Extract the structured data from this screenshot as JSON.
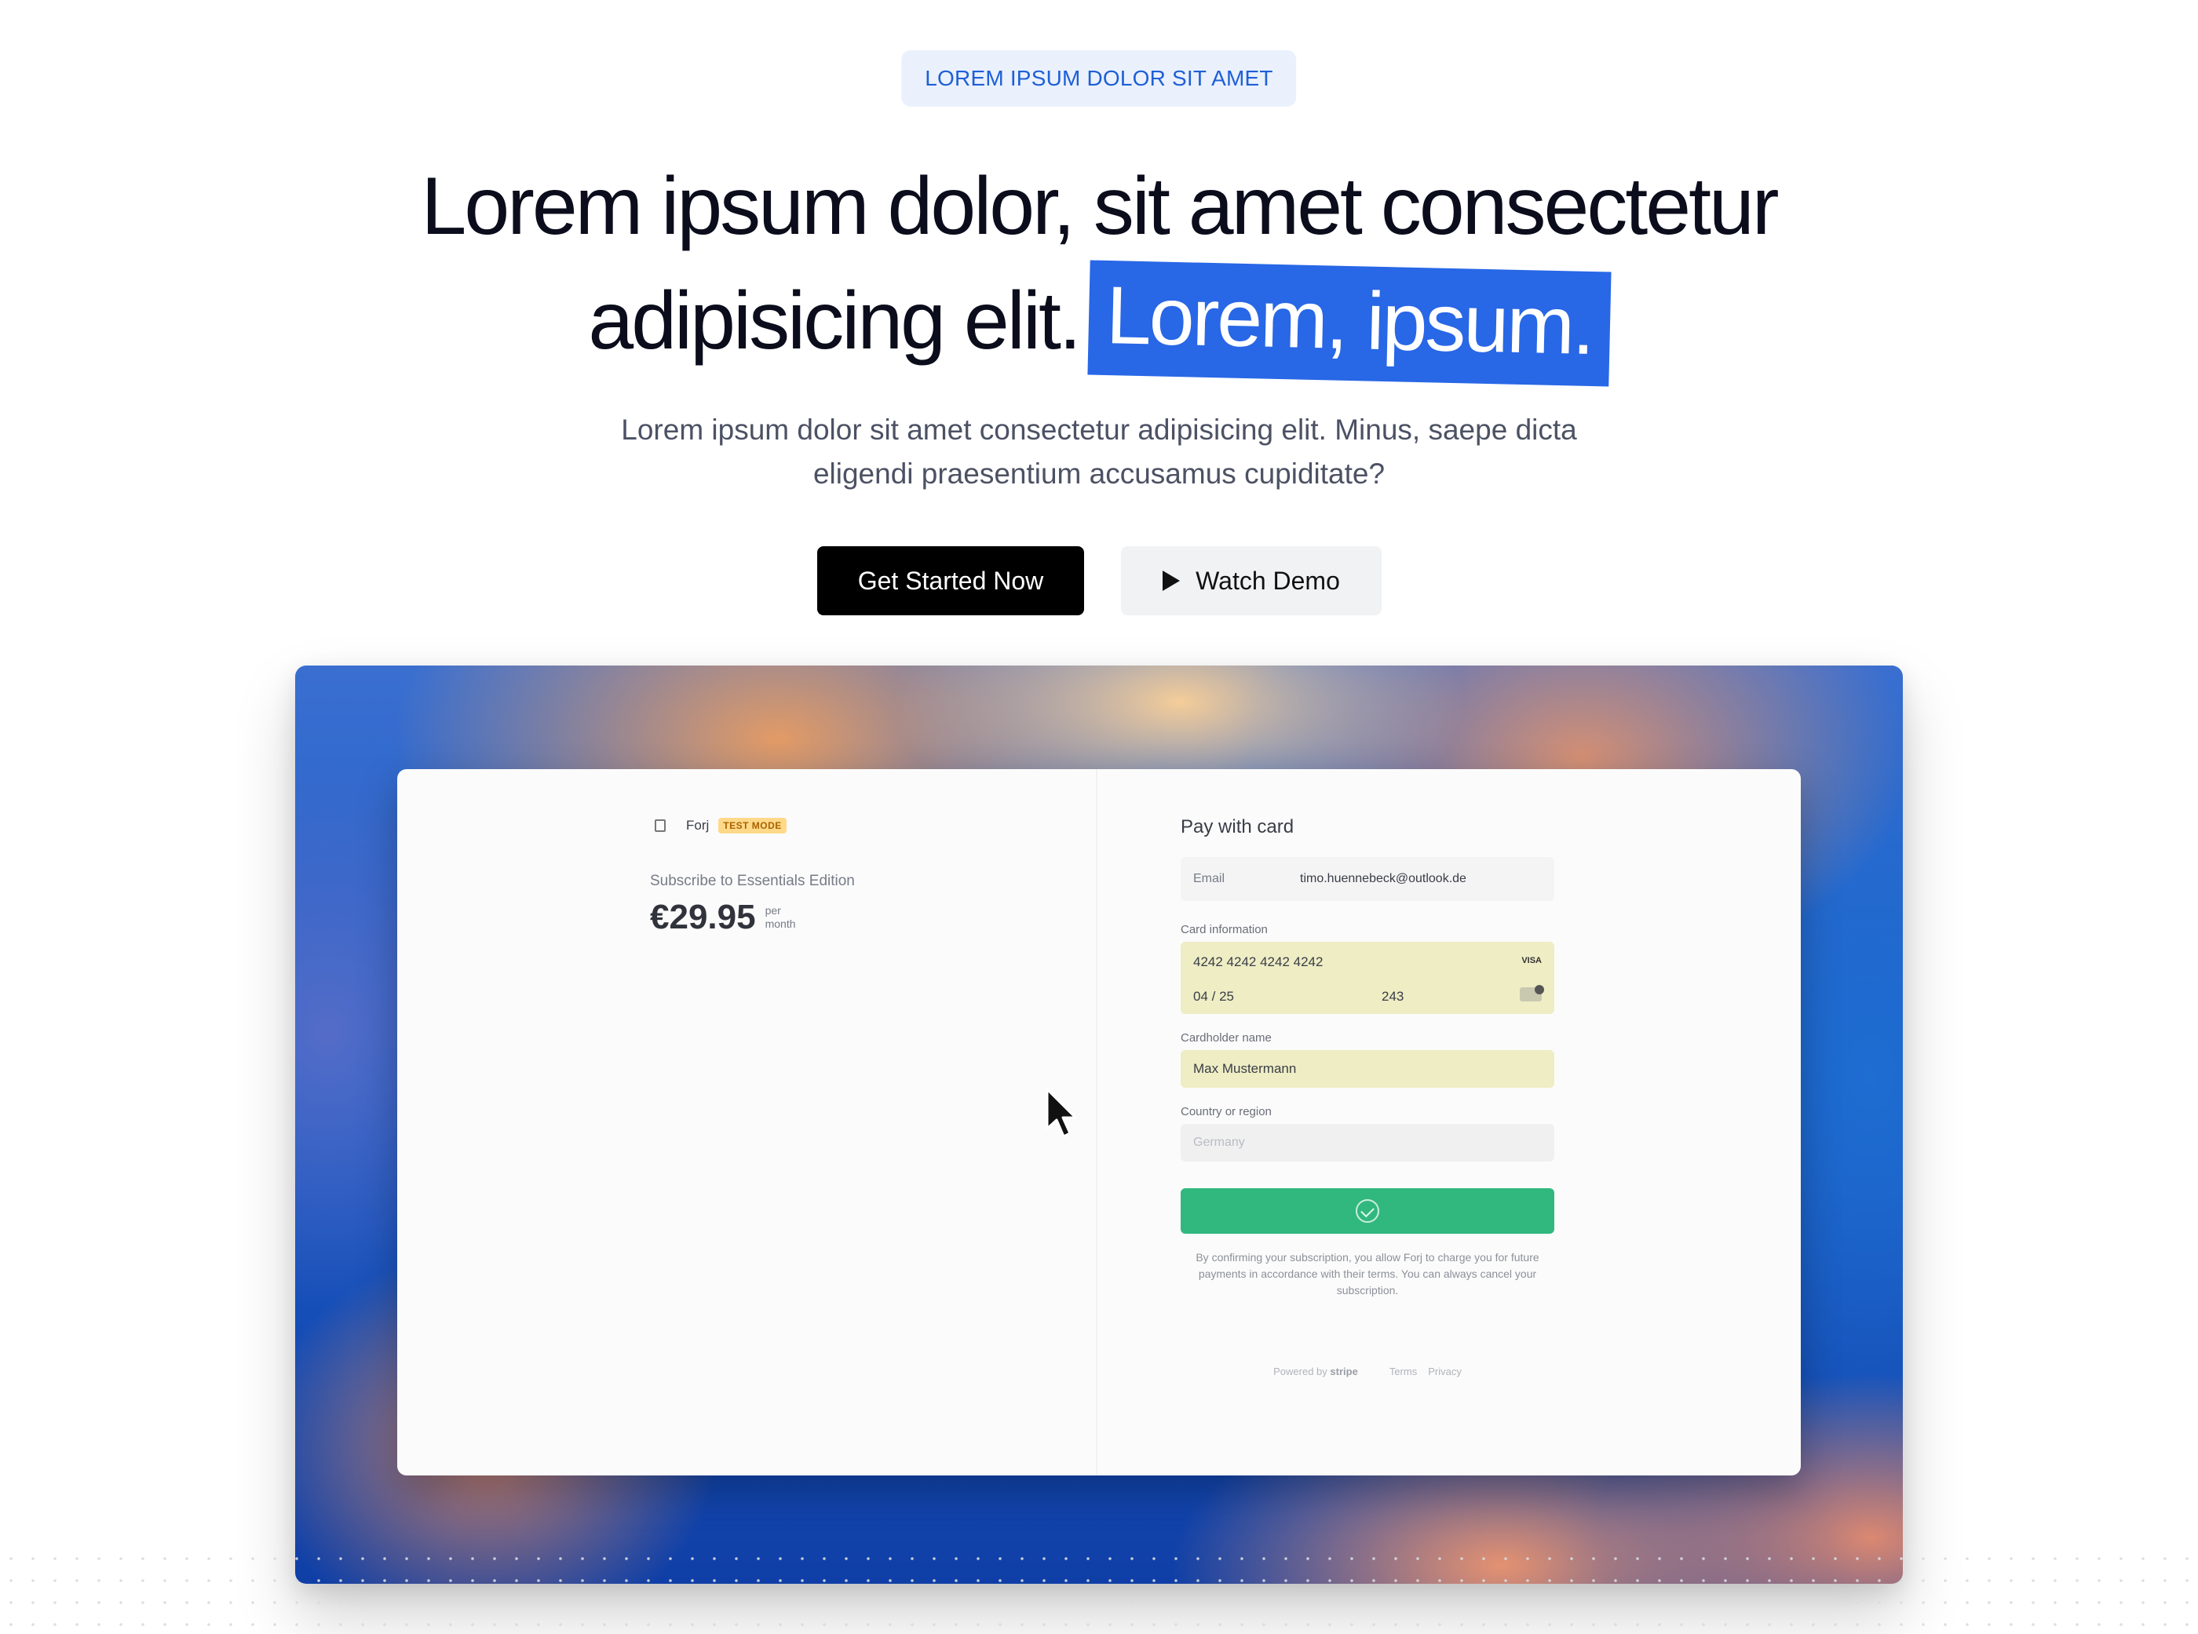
{
  "hero": {
    "eyebrow": "LOREM IPSUM DOLOR SIT AMET",
    "title_line1": "Lorem ipsum dolor, sit amet consectetur",
    "title_line2": "adipisicing elit.",
    "title_highlight": "Lorem, ipsum.",
    "subtitle": "Lorem ipsum dolor sit amet consectetur adipisicing elit. Minus, saepe dicta eligendi praesentium accusamus cupiditate?",
    "primary_cta": "Get Started Now",
    "secondary_cta": "Watch Demo"
  },
  "checkout": {
    "brand": "Forj",
    "mode_badge": "TEST MODE",
    "product": "Subscribe to Essentials Edition",
    "price": "€29.95",
    "period_line1": "per",
    "period_line2": "month",
    "pay_title": "Pay with card",
    "email_label": "Email",
    "email_value": "timo.huennebeck@outlook.de",
    "card_label": "Card information",
    "card_number": "4242 4242 4242 4242",
    "card_brand": "VISA",
    "card_expiry": "04 / 25",
    "card_cvc": "243",
    "name_label": "Cardholder name",
    "name_value": "Max Mustermann",
    "country_label": "Country or region",
    "country_value": "Germany",
    "consent": "By confirming your subscription, you allow Forj to charge you for future payments in accordance with their terms. You can always cancel your subscription.",
    "powered_by": "Powered by",
    "powered_brand": "stripe",
    "terms": "Terms",
    "privacy": "Privacy"
  },
  "colors": {
    "accent": "#2867e6",
    "eyebrow_bg": "#eaf1fd",
    "pay_button": "#31b87e",
    "autofill": "#eeedc4"
  }
}
